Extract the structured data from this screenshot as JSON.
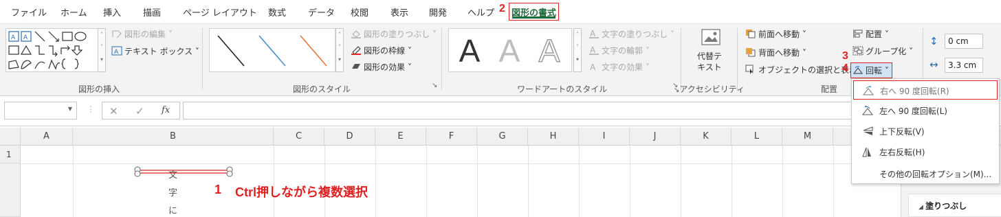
{
  "tabs": [
    {
      "label": "ファイル"
    },
    {
      "label": "ホーム"
    },
    {
      "label": "挿入"
    },
    {
      "label": "描画"
    },
    {
      "label": "ページ レイアウト"
    },
    {
      "label": "数式"
    },
    {
      "label": "データ"
    },
    {
      "label": "校閲"
    },
    {
      "label": "表示"
    },
    {
      "label": "開発"
    },
    {
      "label": "ヘルプ"
    },
    {
      "label": "図形の書式"
    }
  ],
  "steps": {
    "s1": "1",
    "s2": "2",
    "s3": "3",
    "s4": "4"
  },
  "ribbon": {
    "insert_shapes": {
      "label": "図形の挿入",
      "edit_shape": "図形の編集",
      "textbox": "テキスト ボックス"
    },
    "shape_styles": {
      "label": "図形のスタイル",
      "fill": "図形の塗りつぶし",
      "outline": "図形の枠線",
      "effects": "図形の効果"
    },
    "wordart": {
      "label": "ワードアートのスタイル",
      "letter": "A",
      "text_fill": "文字の塗りつぶし",
      "text_outline": "文字の輪郭",
      "text_effects": "文字の効果"
    },
    "accessibility": {
      "label": "アクセシビリティ",
      "alt_text": "代替テキスト"
    },
    "arrange": {
      "label": "配置",
      "bring_forward": "前面へ移動",
      "send_backward": "背面へ移動",
      "selection_pane": "オブジェクトの選択と表示",
      "align": "配置",
      "group": "グループ化",
      "rotate": "回転"
    },
    "size": {
      "height": "0 cm",
      "width": "3.3 cm"
    }
  },
  "formula_bar": {
    "fx": "fx",
    "cancel": "✕",
    "enter": "✓"
  },
  "columns": [
    "A",
    "B",
    "C",
    "D",
    "E",
    "F",
    "G",
    "H",
    "I",
    "J",
    "K",
    "L",
    "M"
  ],
  "rows": [
    "1"
  ],
  "cell_text": [
    "文",
    "字",
    "に"
  ],
  "annotation": {
    "step_number": "1",
    "text": "Ctrl押しながら複数選択"
  },
  "rotate_menu": [
    {
      "label": "右へ 90 度回転(R)",
      "icon": "rotate-right-icon"
    },
    {
      "label": "左へ 90 度回転(L)",
      "icon": "rotate-left-icon"
    },
    {
      "label": "上下反転(V)",
      "icon": "flip-vertical-icon"
    },
    {
      "label": "左右反転(H)",
      "icon": "flip-horizontal-icon"
    },
    {
      "label": "その他の回転オプション(M)..."
    }
  ],
  "side_pane": {
    "fill_section": "塗りつぶし"
  },
  "colors": {
    "accent": "#1f6b3e",
    "highlight": "#e02020"
  }
}
